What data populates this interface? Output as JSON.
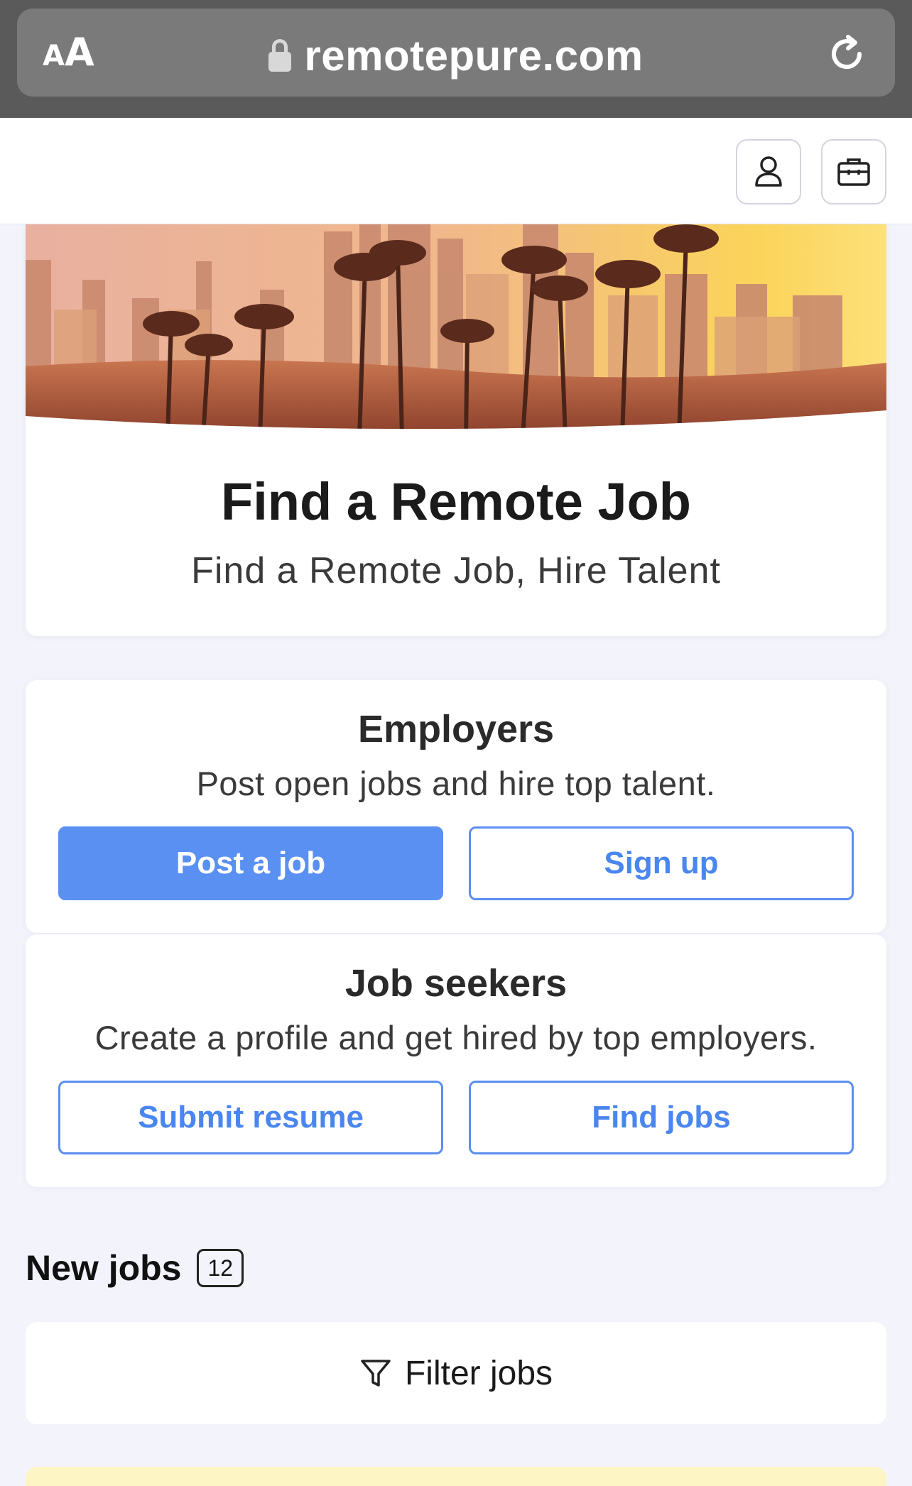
{
  "browser": {
    "aa_small": "A",
    "aa_large": "A",
    "url": "remotepure.com"
  },
  "header": {
    "icons": [
      "user-icon",
      "briefcase-icon"
    ]
  },
  "hero": {
    "title": "Find a Remote Job",
    "subtitle": "Find a Remote Job, Hire Talent"
  },
  "employers": {
    "title": "Employers",
    "description": "Post open jobs and hire top talent.",
    "primary_button": "Post a job",
    "secondary_button": "Sign up"
  },
  "seekers": {
    "title": "Job seekers",
    "description": "Create a profile and get hired by top employers.",
    "left_button": "Submit resume",
    "right_button": "Find jobs"
  },
  "new_jobs": {
    "title": "New jobs",
    "count": "12",
    "filter_label": "Filter jobs"
  },
  "colors": {
    "accent": "#5b90f3",
    "page_bg": "#f3f4fb",
    "highlight_card": "#fdf5c4"
  }
}
